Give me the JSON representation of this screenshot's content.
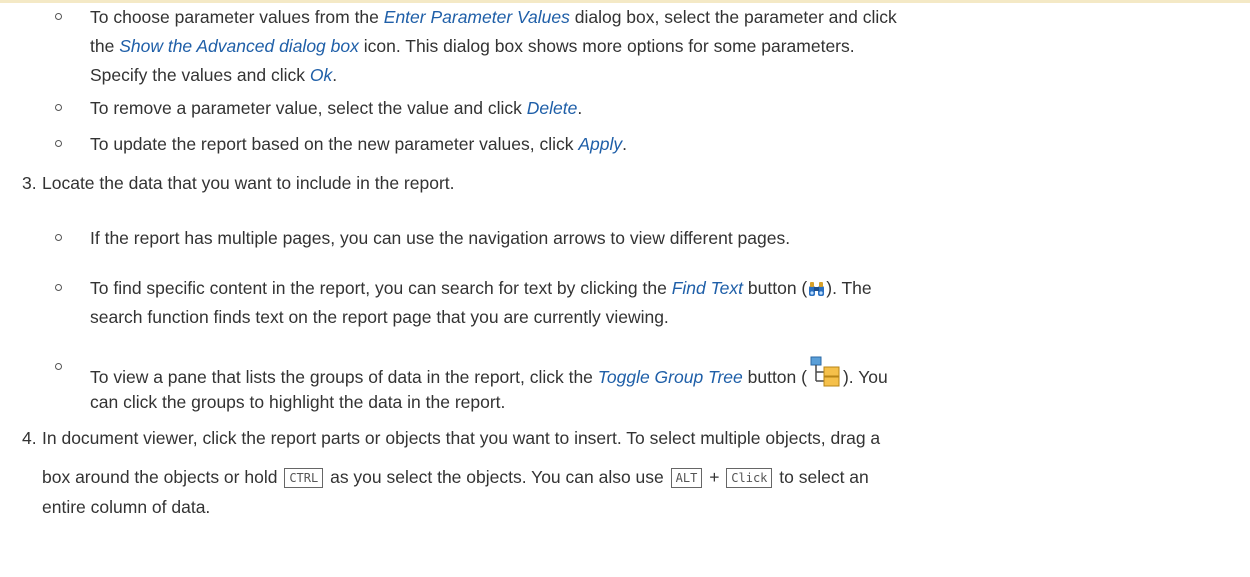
{
  "steps": {
    "step2_bullets": [
      {
        "line1": [
          "To choose parameter values from the ",
          "Enter Parameter Values",
          " dialog box, select the parameter and click"
        ],
        "line2": [
          "the ",
          "Show the Advanced dialog box",
          " icon. This dialog box shows more options for some parameters."
        ],
        "line3": [
          "Specify the values and click ",
          "Ok",
          "."
        ]
      },
      {
        "line1": [
          "To remove a parameter value, select the value and click ",
          "Delete",
          "."
        ]
      },
      {
        "line1": [
          "To update the report based on the new parameter values, click ",
          "Apply",
          "."
        ]
      }
    ],
    "step3": {
      "number": "3.",
      "text": "Locate the data that you want to include in the report.",
      "bullets": [
        {
          "line1": "If the report has multiple pages, you can use the navigation arrows to view different pages."
        },
        {
          "line1": [
            "To find specific content in the report, you can search for text by clicking the ",
            "Find Text",
            " button (",
            "). The"
          ],
          "line2": "search function finds text on the report page that you are currently viewing.",
          "icon": "binoculars-icon"
        },
        {
          "line1": [
            "To view a pane that lists the groups of data in the report, click the ",
            "Toggle Group Tree",
            " button (",
            "). You"
          ],
          "line2": "can click the groups to highlight the data in the report.",
          "icon": "group-tree-icon"
        }
      ]
    },
    "step4": {
      "number": "4.",
      "line1": "In document viewer, click the report parts or objects that you want to insert. To select multiple objects, drag a",
      "line2": [
        "box around the objects or hold ",
        "CTRL",
        " as you select the objects. You can also use ",
        "ALT",
        " + ",
        "Click",
        " to select an"
      ],
      "line3": "entire column of data."
    }
  }
}
